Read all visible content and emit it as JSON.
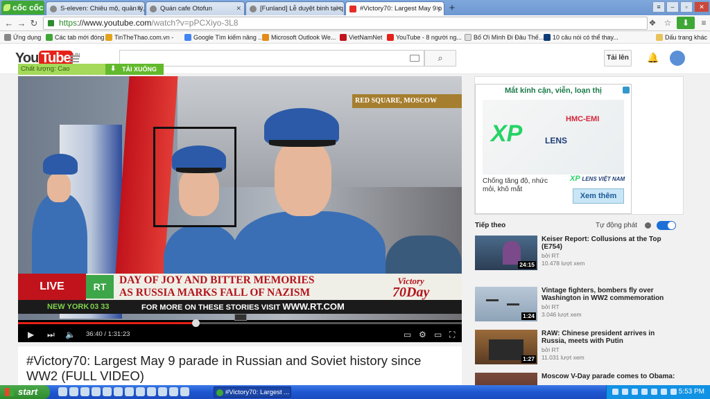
{
  "browser": {
    "logo_label": "cốc cốc",
    "tabs": [
      {
        "label": "S-eleven: Chiêu mộ, quản lý,",
        "active": false
      },
      {
        "label": "Quán cafe Otofun",
        "active": false
      },
      {
        "label": "[Funland] Lễ duyệt binh tại q",
        "active": false
      },
      {
        "label": "#Victory70: Largest May 9 p",
        "active": true
      }
    ],
    "new_tab_label": "+",
    "url": {
      "protocol": "https",
      "host": "://www.youtube.com",
      "path": "/watch?v=pPCXiyo-3L8"
    },
    "bookmarks": [
      {
        "label": "Ứng dụng"
      },
      {
        "label": "Các tab mới đóng"
      },
      {
        "label": "TinTheThao.com.vn -"
      },
      {
        "label": "Google Tìm kiếm nâng ..."
      },
      {
        "label": "Microsoft Outlook We..."
      },
      {
        "label": "VietNamNet"
      },
      {
        "label": "YouTube - 8 người ng..."
      },
      {
        "label": "Bố Ơi Mình Đi Đâu Thế..."
      },
      {
        "label": "10 câu nói có thể thay..."
      },
      {
        "label": "Dấu trang khác"
      }
    ]
  },
  "youtube": {
    "logo_you": "You",
    "logo_tube": "Tube",
    "logo_region": "VN",
    "upload_label": "Tải lên",
    "quality_label": "Chất lượng: Cao",
    "download_label": "TẢI XUỐNG"
  },
  "video": {
    "location_banner": "RED SQUARE, MOSCOW",
    "live_label": "LIVE",
    "channel_bug": "RT",
    "headline_line1": "DAY OF JOY AND BITTER MEMORIES",
    "headline_line2": "AS RUSSIA MARKS FALL OF NAZISM",
    "victory_label_1": "Victory",
    "victory_label_2": "70Day",
    "city_label": "NEW YORK",
    "city_time": "03 33",
    "more_label": "FOR MORE ON THESE STORIES VISIT",
    "more_url": "WWW.RT.COM",
    "time_current": "36:40",
    "time_total": "/ 1:31:23",
    "progress_played": 0.4,
    "progress_buffered": 0.4
  },
  "title": "#Victory70: Largest May 9 parade in Russian and Soviet history since WW2 (FULL VIDEO)",
  "ad": {
    "headline": "Mắt kính cận, viễn, loạn thị",
    "brand_xp": "XP",
    "brand_lens": "LENS",
    "hmc_label": "HMC-EMI",
    "body": "Chống tăng độ, nhức mỏi, khô mắt",
    "brand_small_xp": "XP",
    "brand_small_suffix": "LENS VIỆT NAM",
    "cta": "Xem thêm"
  },
  "sidebar": {
    "up_next_label": "Tiếp theo",
    "autoplay_label": "Tự động phát",
    "items": [
      {
        "title": "Keiser Report: Collusions at the Top (E754)",
        "channel": "bởi RT",
        "views": "10.478 lượt xem",
        "duration": "24:15"
      },
      {
        "title": "Vintage fighters, bombers fly over Washington in WW2 commemoration",
        "channel": "bởi RT",
        "views": "3.046 lượt xem",
        "duration": "1:24"
      },
      {
        "title": "RAW: Chinese president arrives in Russia, meets with Putin",
        "channel": "bởi RT",
        "views": "11.031 lượt xem",
        "duration": "1:27"
      },
      {
        "title": "Moscow V-Day parade comes to Obama:",
        "channel": "",
        "views": "",
        "duration": ""
      }
    ]
  },
  "taskbar": {
    "start_label": "start",
    "task_label": "#Victory70: Largest ...",
    "clock": "5:53 PM"
  },
  "colors": {
    "youtube_red": "#e62117",
    "rt_green": "#3da648",
    "coccoc_green": "#3fa736",
    "xp_blue": "#1b5a96"
  }
}
